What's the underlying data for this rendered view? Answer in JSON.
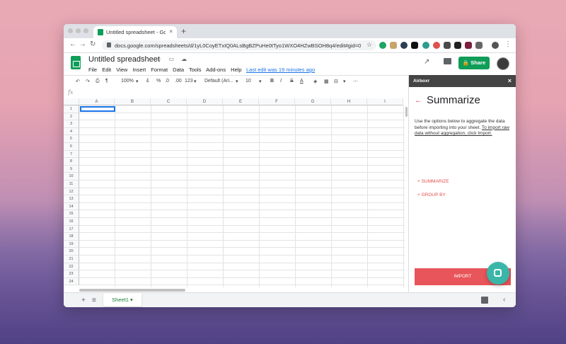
{
  "browser": {
    "tab_title": "Untitled spreadsheet - Google",
    "tab_close": "×",
    "new_tab": "+",
    "url": "docs.google.com/spreadsheets/d/1yL0CoyETxIQ0ALsBgBZPuHe0tTyo1WXO4HZwBSOH8q4/edit#gid=0",
    "back": "←",
    "forward": "→",
    "reload": "↻",
    "bookmark": "☆",
    "menu": "⋮"
  },
  "sheets": {
    "title": "Untitled spreadsheet",
    "title_icons": "☆ ▭ ☁",
    "menus": [
      "File",
      "Edit",
      "View",
      "Insert",
      "Format",
      "Data",
      "Tools",
      "Add-ons",
      "Help"
    ],
    "last_edit": "Last edit was 19 minutes ago",
    "share_label": "Share",
    "trend_icon": "↗"
  },
  "toolbar": {
    "zoom": "100%",
    "currency": "£",
    "percent": "%",
    "dec_less": ".0",
    "dec_more": ".00",
    "format_num": "123",
    "font": "Default (Ari...",
    "font_size": "10",
    "bold": "B",
    "italic": "I",
    "strike": "S",
    "text_color": "A",
    "more": "⋯"
  },
  "formula": {
    "fx": "fx"
  },
  "grid": {
    "columns": [
      "A",
      "B",
      "C",
      "D",
      "E",
      "F",
      "G",
      "H",
      "I"
    ],
    "rows": [
      "1",
      "2",
      "3",
      "4",
      "5",
      "6",
      "7",
      "8",
      "9",
      "10",
      "11",
      "12",
      "13",
      "14",
      "15",
      "16",
      "17",
      "18",
      "19",
      "20",
      "21",
      "22",
      "23",
      "24"
    ]
  },
  "sheet_tabs": {
    "add": "+",
    "list": "≡",
    "active": "Sheet1",
    "active_caret": "▾",
    "collapse": "‹"
  },
  "panel": {
    "app_name": "Airboxr",
    "close": "×",
    "back": "←",
    "title": "Summarize",
    "description": "Use the options below to aggregate the data before importing into your sheet. ",
    "description_link": "To import raw data without aggregation, click Import.",
    "summarize_link": "+ SUMMARIZE",
    "group_by_link": "+ GROUP BY",
    "import_label": "IMPORT"
  },
  "colors": {
    "sheets_green": "#0f9d58",
    "import_red": "#e8555a",
    "link_red": "#e0504d",
    "chat_teal": "#39b6a8"
  }
}
